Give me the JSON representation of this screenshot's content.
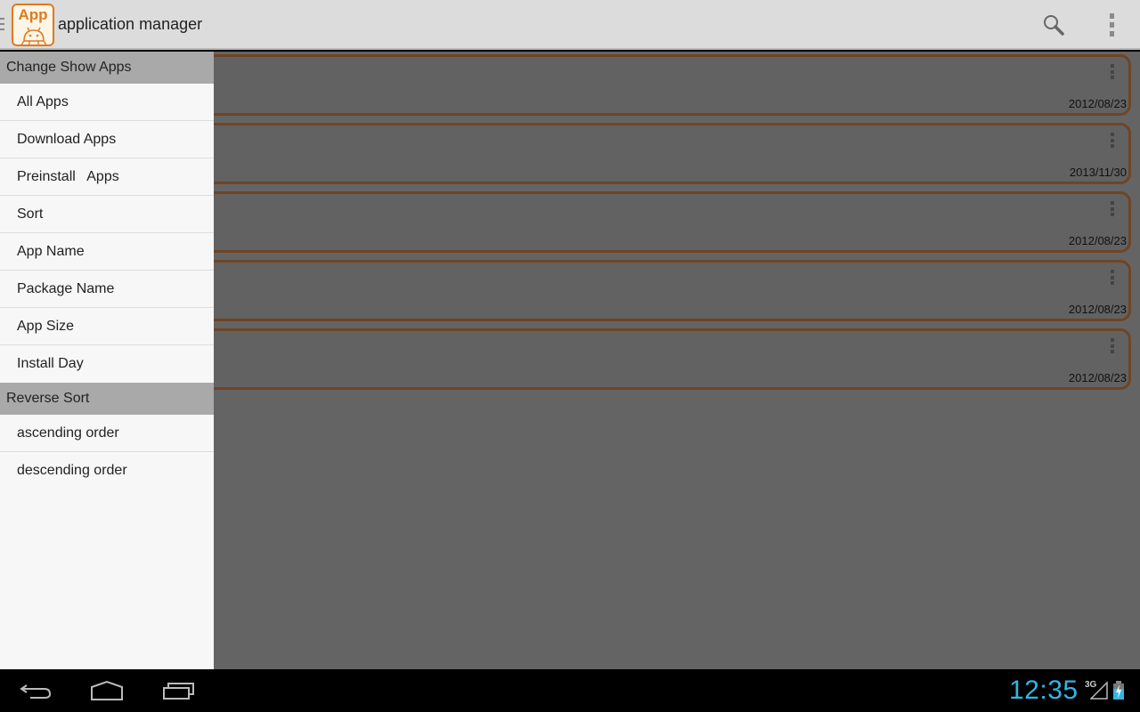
{
  "action_bar": {
    "logo_text": "App",
    "title": "application manager",
    "search_icon": "search-icon",
    "overflow_icon": "overflow-menu-icon"
  },
  "colors": {
    "action_bar_bg": "#dcdcdc",
    "logo_accent": "#e07a1f",
    "content_bg": "#646464",
    "card_border": "#6e4526",
    "drawer_bg": "#f7f7f7",
    "drawer_header_bg": "#a9a9a9",
    "clock_color": "#33b5e5"
  },
  "drawer": {
    "sections": [
      {
        "header": "Change Show Apps",
        "items": [
          "All Apps",
          "Download Apps",
          "Preinstall   Apps"
        ]
      },
      {
        "header": "Sort",
        "items": [
          "App Name",
          "Package Name",
          "App Size",
          "Install Day"
        ]
      },
      {
        "header": "Reverse Sort",
        "items": [
          "ascending order",
          "descending order"
        ]
      }
    ],
    "change_show_apps_header": "Change Show Apps",
    "items_show": [
      "All Apps",
      "Download Apps",
      "Preinstall   Apps"
    ],
    "sort_label": "Sort",
    "items_sort": [
      "App Name",
      "Package Name",
      "App Size",
      "Install Day"
    ],
    "reverse_sort_header": "Reverse Sort",
    "items_reverse": [
      "ascending order",
      "descending order"
    ]
  },
  "app_list": {
    "cards": [
      {
        "date": "2012/08/23"
      },
      {
        "date": "2013/11/30"
      },
      {
        "date": "2012/08/23"
      },
      {
        "date": "2012/08/23"
      },
      {
        "date": "2012/08/23"
      }
    ]
  },
  "system_bar": {
    "nav_buttons": [
      "back",
      "home",
      "recent-apps"
    ],
    "clock": "12:35",
    "network": "3G"
  }
}
